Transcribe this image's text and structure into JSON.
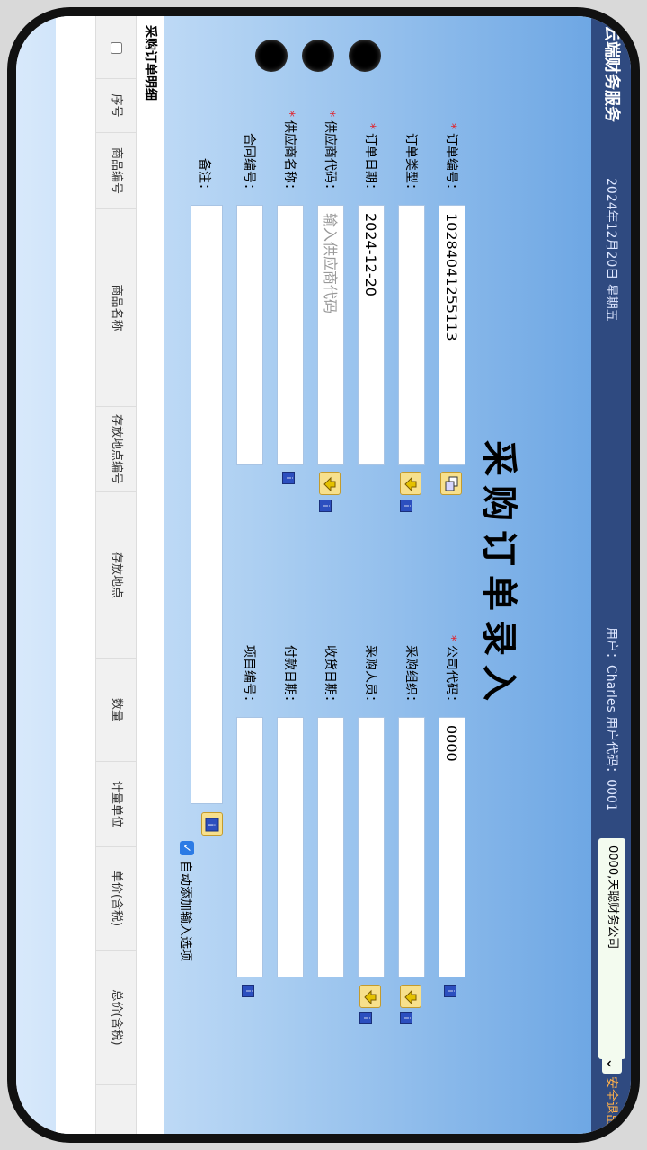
{
  "app": {
    "brand": "云端财务服务",
    "date": "2024年12月20日 星期五",
    "user_text": "用户：Charles  用户代码：0001",
    "company_select": "0000,天聪财务公司",
    "logout": "安全退出"
  },
  "page": {
    "title": "采购订单录入"
  },
  "form": {
    "left": [
      {
        "label": "订单编号：",
        "value": "10284041255113",
        "required": true
      },
      {
        "label": "订单类型：",
        "value": "",
        "required": false
      },
      {
        "label": "订单日期：",
        "value": "2024-12-20",
        "required": true
      },
      {
        "label": "供应商代码：",
        "value": "",
        "placeholder": "输入供应商代码",
        "required": true
      },
      {
        "label": "供应商名称：",
        "value": "",
        "required": false
      },
      {
        "label": "合同编号：",
        "value": "",
        "required": false
      }
    ],
    "right": [
      {
        "label": "公司代码：",
        "value": "0000",
        "required": true
      },
      {
        "label": "采购组织：",
        "value": "",
        "required": false
      },
      {
        "label": "采购人员：",
        "value": "",
        "required": false
      },
      {
        "label": "收货日期：",
        "value": "",
        "required": false
      },
      {
        "label": "付款日期：",
        "value": "",
        "required": false
      },
      {
        "label": "项目编号：",
        "value": "",
        "required": false
      }
    ],
    "notes_label": "备注：",
    "auto_add_label": "自动添加输入选项",
    "auto_add_checked": true
  },
  "table": {
    "title": "采购订单明细",
    "columns": [
      "序号",
      "商品编号",
      "商品名称",
      "存放地点编号",
      "存放地点",
      "数量",
      "计量单位",
      "单价(含税)",
      "总价(含税)"
    ]
  }
}
